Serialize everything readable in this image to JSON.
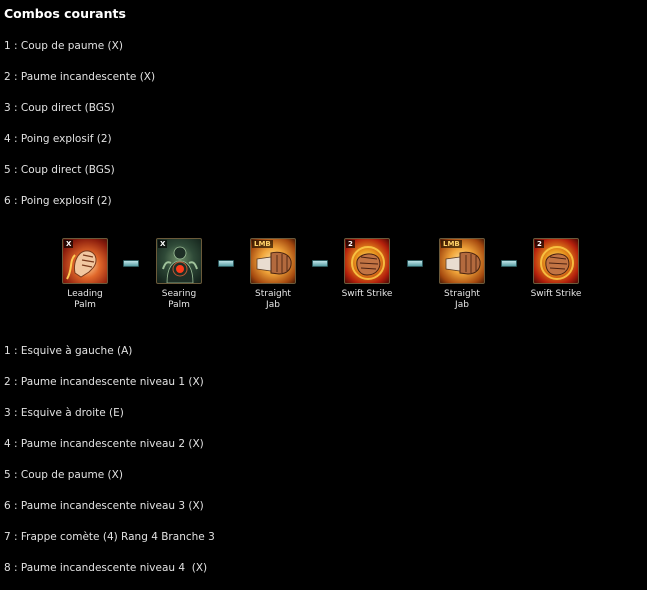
{
  "heading": "Combos courants",
  "combo1": [
    "1 : Coup de paume (X)",
    "2 : Paume incandescente (X)",
    "3 : Coup direct (BGS)",
    "4 : Poing explosif (2)",
    "5 : Coup direct (BGS)",
    "6 : Poing explosif (2)"
  ],
  "skills": [
    {
      "badge": "X",
      "label_line1": "Leading",
      "label_line2": "Palm",
      "icon": "leading-palm-icon"
    },
    {
      "badge": "X",
      "label_line1": "Searing",
      "label_line2": "Palm",
      "icon": "searing-palm-icon"
    },
    {
      "badge": "LMB",
      "label_line1": "Straight",
      "label_line2": "Jab",
      "icon": "straight-jab-icon"
    },
    {
      "badge": "2",
      "label_line1": "Swift Strike",
      "label_line2": "",
      "icon": "swift-strike-icon"
    },
    {
      "badge": "LMB",
      "label_line1": "Straight",
      "label_line2": "Jab",
      "icon": "straight-jab-icon"
    },
    {
      "badge": "2",
      "label_line1": "Swift Strike",
      "label_line2": "",
      "icon": "swift-strike-icon"
    }
  ],
  "combo2": [
    "1 : Esquive à gauche (A)",
    "2 : Paume incandescente niveau 1 (X)",
    "3 : Esquive à droite (E)",
    "4 : Paume incandescente niveau 2 (X)",
    "5 : Coup de paume (X)",
    "6 : Paume incandescente niveau 3 (X)",
    "7 : Frappe comète (4) Rang 4 Branche 3",
    "8 : Paume incandescente niveau 4  (X)"
  ]
}
